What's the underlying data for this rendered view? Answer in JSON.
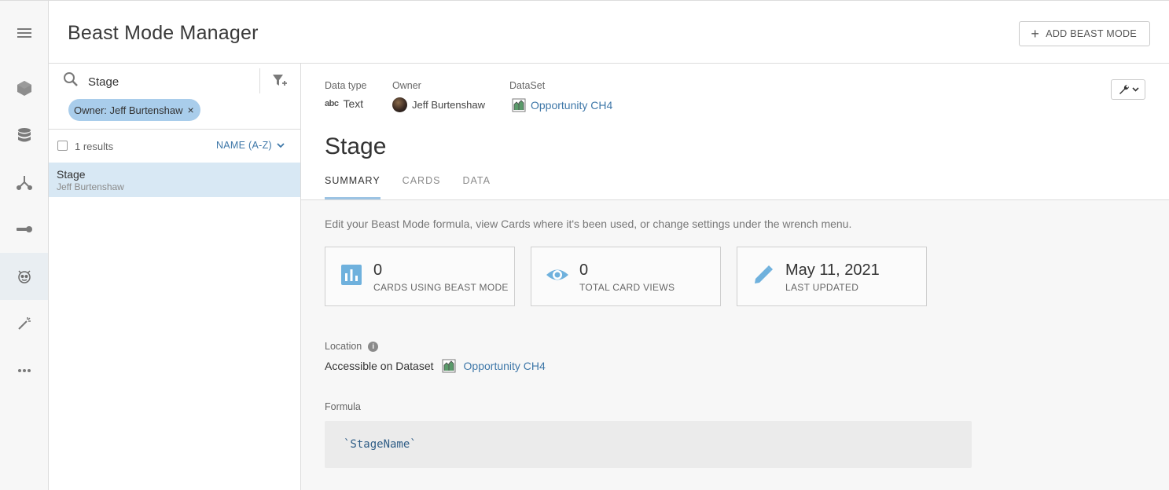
{
  "header": {
    "title": "Beast Mode Manager",
    "add_button_label": "ADD BEAST MODE"
  },
  "rail": {
    "items": [
      "menu-icon",
      "cube-icon",
      "database-icon",
      "fork-icon",
      "key-icon",
      "beast-mode-icon",
      "magic-wand-icon",
      "more-icon"
    ],
    "active_item": "beast-mode-icon"
  },
  "search": {
    "value": "Stage",
    "placeholder": "",
    "filter_chip": "Owner: Jeff Burtenshaw"
  },
  "results": {
    "count_text": "1 results",
    "sort_label": "NAME (A-Z)",
    "items": [
      {
        "name": "Stage",
        "owner": "Jeff Burtenshaw"
      }
    ]
  },
  "detail": {
    "meta": {
      "data_type_label": "Data type",
      "data_type_glyph": "abc",
      "data_type_value": "Text",
      "owner_label": "Owner",
      "owner_value": "Jeff Burtenshaw",
      "dataset_label": "DataSet",
      "dataset_value": "Opportunity CH4"
    },
    "title": "Stage",
    "tabs": [
      "SUMMARY",
      "CARDS",
      "DATA"
    ],
    "active_tab": "SUMMARY",
    "hint": "Edit your Beast Mode formula, view Cards where it's been used, or change settings under the wrench menu.",
    "stats": [
      {
        "value": "0",
        "label": "CARDS USING BEAST MODE",
        "icon": "bar-chart-icon"
      },
      {
        "value": "0",
        "label": "TOTAL CARD VIEWS",
        "icon": "eye-icon"
      },
      {
        "value": "May 11, 2021",
        "label": "LAST UPDATED",
        "icon": "pencil-icon"
      }
    ],
    "location": {
      "label": "Location",
      "prefix": "Accessible on Dataset",
      "dataset": "Opportunity CH4"
    },
    "formula": {
      "label": "Formula",
      "text": "`StageName`"
    }
  },
  "colors": {
    "accent": "#3e77a8",
    "chip": "#a9cdeb",
    "selected_row": "#d8e8f4",
    "stat_icon": "#6fb1dd"
  }
}
